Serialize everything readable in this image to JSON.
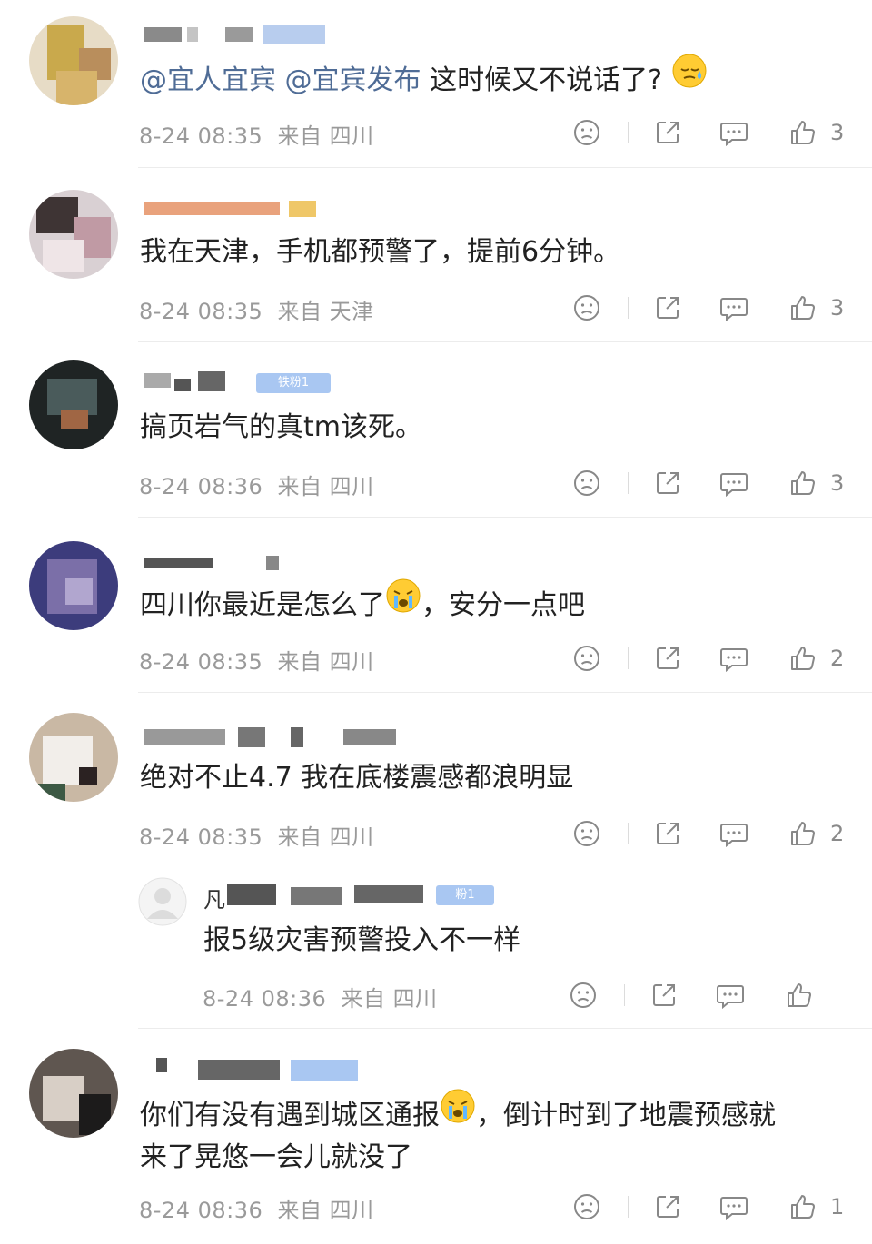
{
  "comments": [
    {
      "text_parts": [
        {
          "t": "@宜人宜宾",
          "link": true
        },
        {
          "t": " "
        },
        {
          "t": "@宜宾发布",
          "link": true
        },
        {
          "t": " 这时候又不说话了?"
        }
      ],
      "emoji": "sweat-face",
      "time": "8-24 08:35",
      "location": "来自 四川",
      "likes": "3"
    },
    {
      "text_parts": [
        {
          "t": "我在天津，手机都预警了，提前6分钟。"
        }
      ],
      "time": "8-24 08:35",
      "location": "来自 天津",
      "likes": "3"
    },
    {
      "text_parts": [
        {
          "t": "搞页岩气的真tm该死。"
        }
      ],
      "badge": "铁粉1",
      "time": "8-24 08:36",
      "location": "来自 四川",
      "likes": "3"
    },
    {
      "text_parts": [
        {
          "t": "四川你最近是怎么了"
        },
        {
          "emoji": "crying-face"
        },
        {
          "t": "，安分一点吧"
        }
      ],
      "time": "8-24 08:35",
      "location": "来自 四川",
      "likes": "2"
    },
    {
      "text_parts": [
        {
          "t": "绝对不止4.7 我在底楼震感都浪明显"
        }
      ],
      "time": "8-24 08:35",
      "location": "来自 四川",
      "likes": "2"
    },
    {
      "reply": true,
      "name_prefix": "凡",
      "badge": "粉1",
      "text_parts": [
        {
          "t": "报5级灾害预警投入不一样"
        }
      ],
      "time": "8-24 08:36",
      "location": "来自 四川",
      "likes": ""
    },
    {
      "text_parts": [
        {
          "t": "你们有没有遇到城区通报"
        },
        {
          "emoji": "crying-face"
        },
        {
          "t": "，倒计时到了地震预感就"
        }
      ],
      "text_line2": "来了晃悠一会儿就没了",
      "time": "8-24 08:36",
      "location": "来自 四川",
      "likes": "1"
    }
  ],
  "icons": {
    "dislike": "sad-face-icon",
    "share": "share-icon",
    "comment": "comment-bubble-icon",
    "like": "thumbs-up-icon"
  },
  "colors": {
    "link": "#4f6c96",
    "meta": "#9a9a9a",
    "icon": "#888888"
  }
}
